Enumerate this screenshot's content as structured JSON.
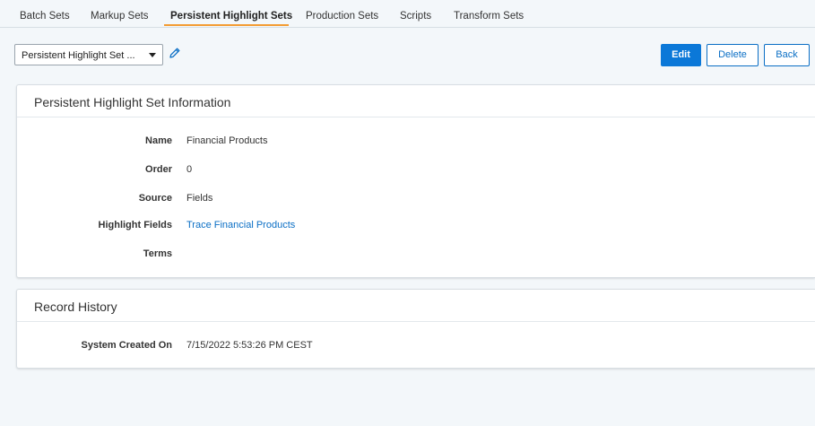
{
  "tabs": [
    {
      "label": "Batch Sets"
    },
    {
      "label": "Markup Sets"
    },
    {
      "label": "Persistent Highlight Sets",
      "active": true
    },
    {
      "label": "Production Sets"
    },
    {
      "label": "Scripts"
    },
    {
      "label": "Transform Sets"
    }
  ],
  "selector": {
    "value": "Persistent Highlight Set ..."
  },
  "icons": {
    "edit_pencil": "pencil-icon",
    "dropdown": "caret-down-icon"
  },
  "colors": {
    "accent": "#0b78d8",
    "tab_underline": "#f39c33",
    "link": "#0b6fc5"
  },
  "actions": {
    "edit": "Edit",
    "delete": "Delete",
    "back": "Back"
  },
  "info_panel": {
    "title": "Persistent Highlight Set Information",
    "fields": [
      {
        "label": "Name",
        "value": "Financial Products"
      },
      {
        "label": "Order",
        "value": "0"
      },
      {
        "label": "Source",
        "value": "Fields"
      },
      {
        "label": "Highlight Fields",
        "value": "Trace Financial Products"
      },
      {
        "label": "Terms",
        "value": ""
      }
    ]
  },
  "history_panel": {
    "title": "Record History",
    "fields": [
      {
        "label": "System Created On",
        "value": "7/15/2022 5:53:26 PM CEST"
      }
    ]
  }
}
